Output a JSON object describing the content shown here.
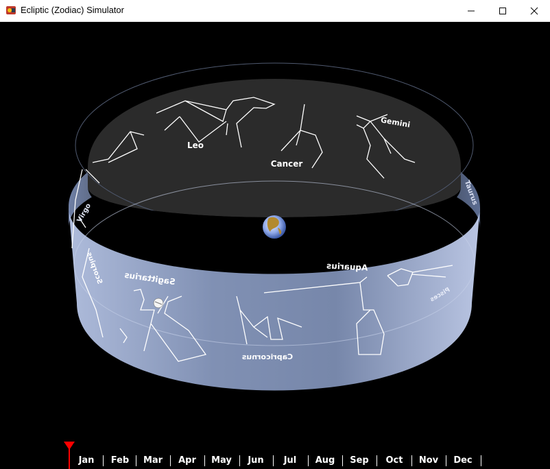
{
  "window": {
    "title": "Ecliptic (Zodiac) Simulator",
    "controls": [
      "minimize",
      "maximize",
      "close"
    ],
    "app_icon": "app-icon"
  },
  "band": {
    "back_labels": {
      "leo": "Leo",
      "cancer": "Cancer",
      "gemini": "Gemini",
      "taurus": "Taurus",
      "virgo": "Virgo"
    },
    "front_labels_mirrored": {
      "sagittarius": "Sagittarius",
      "aquarius": "Aquarius",
      "capricornus": "Capricornus",
      "scorpius": "Scorpius",
      "pisces": "Pisces"
    },
    "center_body": "earth-icon",
    "sun_body": "sun-icon"
  },
  "timeline": {
    "months": [
      "Jan",
      "Feb",
      "Mar",
      "Apr",
      "May",
      "Jun",
      "Jul",
      "Aug",
      "Sep",
      "Oct",
      "Nov",
      "Dec"
    ],
    "marker_color": "#ff0000",
    "current_position_fraction": 0.0
  },
  "colors": {
    "band_front": "#8fa2c8",
    "band_back": "#2f2f2f",
    "constellation_lines": "#ffffff"
  }
}
